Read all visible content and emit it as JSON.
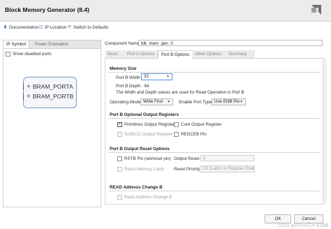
{
  "window": {
    "title": "Block Memory Generator (8.4)"
  },
  "toolbar": {
    "documentation": "Documentation",
    "ip_location": "IP Location",
    "switch_defaults": "Switch to Defaults"
  },
  "left_panel": {
    "tabs": [
      "IP Symbol",
      "Power Estimation"
    ],
    "show_disabled_ports": "Show disabled ports",
    "ports": [
      "BRAM_PORTA",
      "BRAM_PORTB"
    ]
  },
  "component": {
    "label": "Component Name",
    "value": "blk_mem_gen_0"
  },
  "tabs": [
    "Basic",
    "Port A Options",
    "Port B Options",
    "Other Options",
    "Summary"
  ],
  "active_tab": "Port B Options",
  "memory_size": {
    "heading": "Memory Size",
    "width_label": "Port B Width",
    "width_value": "32",
    "depth_text": "Port B Depth : 64",
    "info_text": "The Width and Depth values are used for Read Operation in Port B",
    "op_mode_label": "Operating Mode",
    "op_mode_value": "Write First",
    "enable_type_label": "Enable Port Type",
    "enable_type_value": "Use ENB Pin"
  },
  "optional_output": {
    "heading": "Port B Optional Output Registers",
    "primitives": "Primitives Output Register",
    "primitives_checked": true,
    "core": "Core Output Register",
    "core_checked": false,
    "softecc": "SoftECC Output Register",
    "regceb": "REGCEB Pin"
  },
  "reset_options": {
    "heading": "Port B Output Reset Options",
    "rstb": "RSTB Pin (set/reset pin)",
    "output_reset_label": "Output Reset Value (Hex)",
    "output_reset_value": "0",
    "reset_mem_latch": "Reset Memory Latch",
    "reset_priority_label": "Reset Priority",
    "reset_priority_value": "CE (Latch or Register Enable)"
  },
  "read_address": {
    "heading": "READ Address Change B",
    "read_address_change": "Read Address Change B"
  },
  "buttons": {
    "ok": "OK",
    "cancel": "Cancel"
  },
  "watermark": "CSDN @FPGA|芯片攻城狮"
}
